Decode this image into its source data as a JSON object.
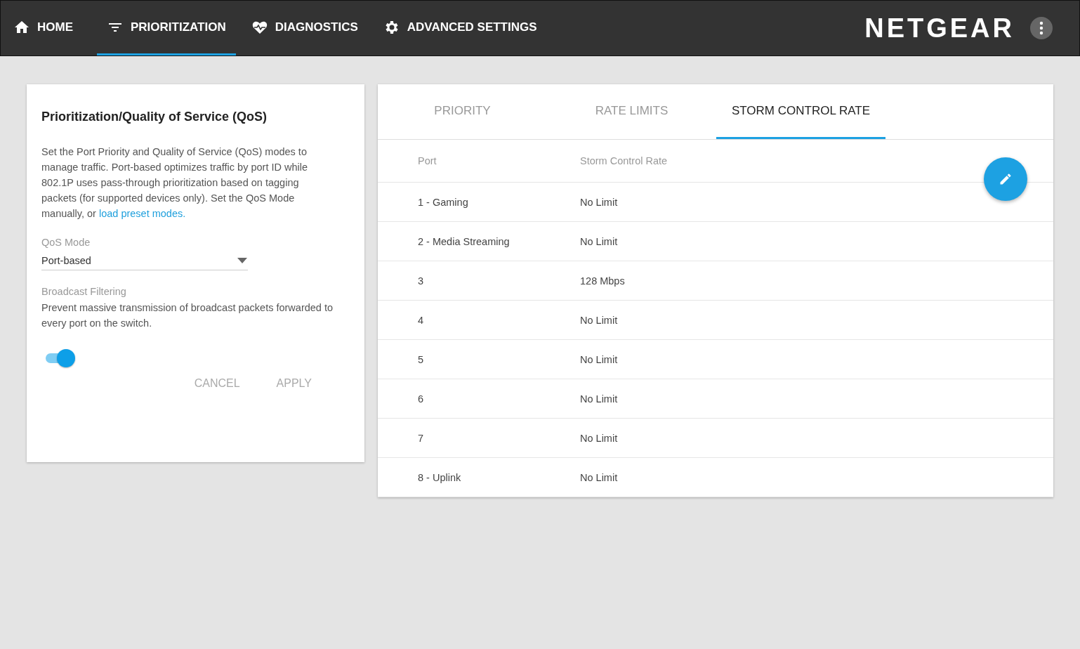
{
  "nav": {
    "items": [
      {
        "kind": "home",
        "label": "HOME",
        "selected": false
      },
      {
        "kind": "filter",
        "label": "PRIORITIZATION",
        "selected": true
      },
      {
        "kind": "heart",
        "label": "DIAGNOSTICS",
        "selected": false
      },
      {
        "kind": "gear",
        "label": "ADVANCED SETTINGS",
        "selected": false
      }
    ],
    "brand": "NETGEAR"
  },
  "qos_card": {
    "title": "Prioritization/Quality of Service (QoS)",
    "description": "Set the Port Priority and Quality of Service (QoS) modes to manage traffic. Port-based optimizes traffic by port ID while 802.1P uses pass-through prioritization based on tagging packets (for supported devices only). Set the QoS Mode manually, or ",
    "description_link": "load preset modes.",
    "qos_mode": {
      "label": "QoS Mode",
      "value": "Port-based"
    },
    "broadcast_filtering": {
      "label": "Broadcast Filtering",
      "description": "Prevent massive transmission of broadcast packets forwarded to every port on the switch.",
      "on": true
    },
    "buttons": [
      {
        "label": "CANCEL",
        "disabled": true
      },
      {
        "label": "APPLY",
        "disabled": true
      }
    ]
  },
  "rate_card": {
    "tabs": [
      {
        "label": "PRIORITY",
        "selected": false
      },
      {
        "label": "RATE LIMITS",
        "selected": false
      },
      {
        "label": "STORM CONTROL RATE",
        "selected": true
      }
    ],
    "table": {
      "columns": [
        "Port",
        "Storm Control Rate"
      ],
      "rows": [
        [
          "1 - Gaming",
          "No Limit"
        ],
        [
          "2 - Media Streaming",
          "No Limit"
        ],
        [
          "3",
          "128 Mbps"
        ],
        [
          "4",
          "No Limit"
        ],
        [
          "5",
          "No Limit"
        ],
        [
          "6",
          "No Limit"
        ],
        [
          "7",
          "No Limit"
        ],
        [
          "8 - Uplink",
          "No Limit"
        ]
      ]
    }
  }
}
